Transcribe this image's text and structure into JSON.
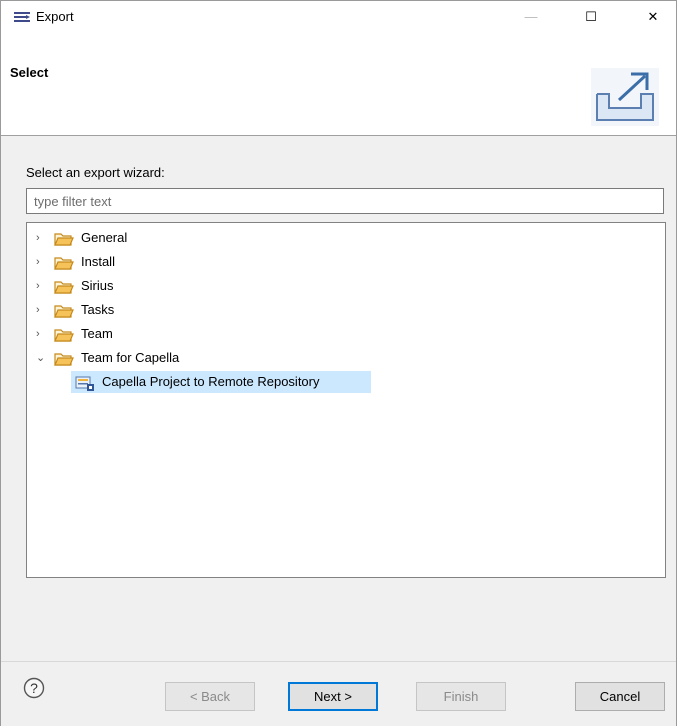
{
  "window": {
    "title": "Export",
    "minimize_glyph": "—",
    "maximize_glyph": "☐",
    "close_glyph": "✕"
  },
  "banner": {
    "title": "Select",
    "icon": "export-wizard-icon"
  },
  "filter": {
    "label": "Select an export wizard:",
    "placeholder": "type filter text",
    "value": ""
  },
  "tree": {
    "items": [
      {
        "label": "General",
        "expanded": false,
        "toggle": "›"
      },
      {
        "label": "Install",
        "expanded": false,
        "toggle": "›"
      },
      {
        "label": "Sirius",
        "expanded": false,
        "toggle": "›"
      },
      {
        "label": "Tasks",
        "expanded": false,
        "toggle": "›"
      },
      {
        "label": "Team",
        "expanded": false,
        "toggle": "›"
      },
      {
        "label": "Team for Capella",
        "expanded": true,
        "toggle": "⌄"
      },
      {
        "label": "Capella Project to Remote Repository",
        "selected": true,
        "leaf": true
      }
    ]
  },
  "footer": {
    "help_glyph": "?",
    "back_label": "< Back",
    "next_label": "Next >",
    "finish_label": "Finish",
    "cancel_label": "Cancel"
  },
  "colors": {
    "selection": "#cce8ff",
    "focus_border": "#0078d7",
    "folder": "#e8a92c"
  }
}
